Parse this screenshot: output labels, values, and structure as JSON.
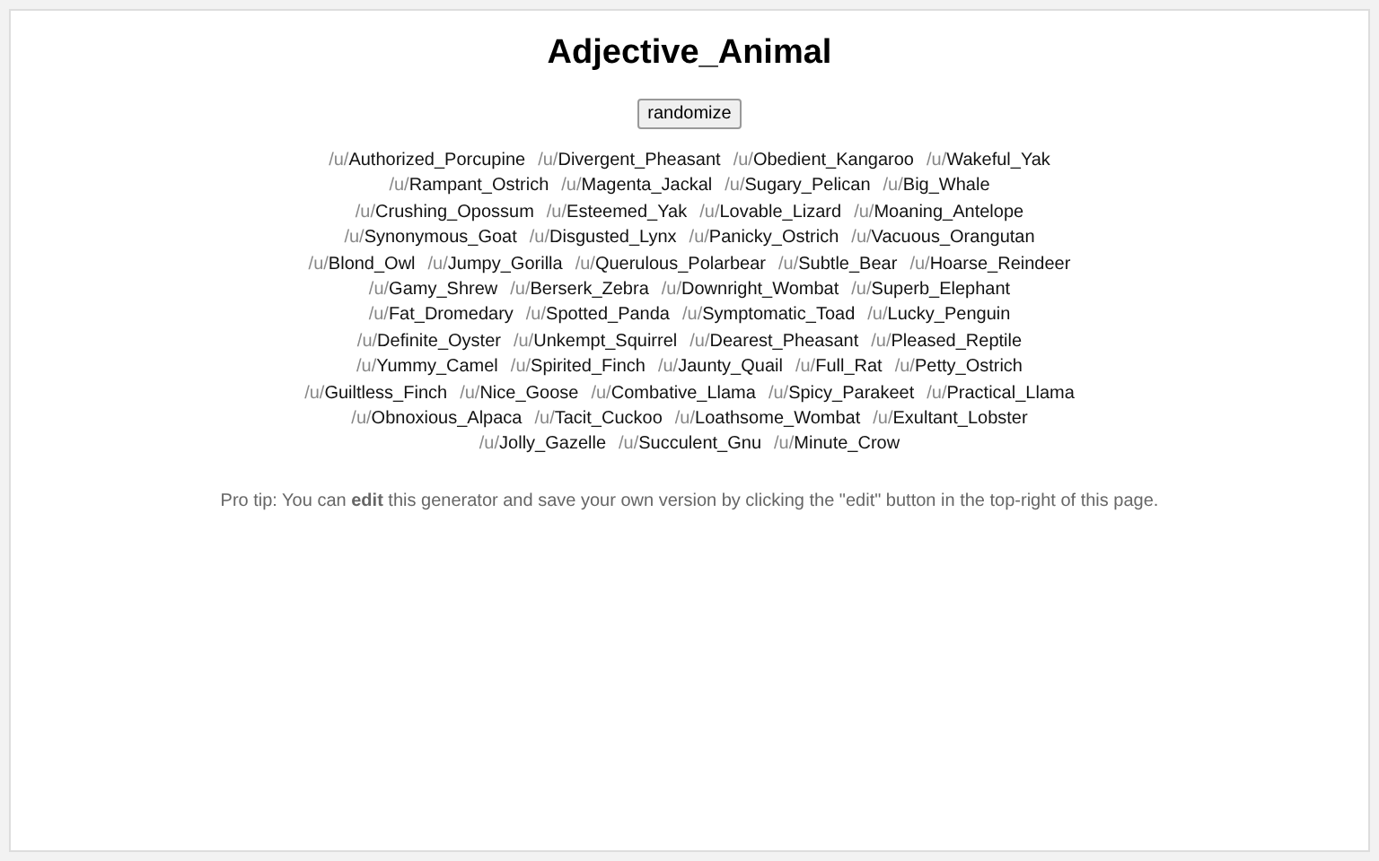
{
  "title": "Adjective_Animal",
  "button": "randomize",
  "lines": [
    [
      {
        "prefix": "/u/",
        "name": "Authorized_Porcupine"
      },
      {
        "prefix": "/u/",
        "name": "Divergent_Pheasant"
      },
      {
        "prefix": "/u/",
        "name": "Obedient_Kangaroo"
      },
      {
        "prefix": "/u/",
        "name": "Wakeful_Yak"
      }
    ],
    [
      {
        "prefix": "/u/",
        "name": "Rampant_Ostrich"
      },
      {
        "prefix": "/u/",
        "name": "Magenta_Jackal"
      },
      {
        "prefix": "/u/",
        "name": "Sugary_Pelican"
      },
      {
        "prefix": "/u/",
        "name": "Big_Whale"
      }
    ],
    [
      {
        "prefix": "/u/",
        "name": "Crushing_Opossum"
      },
      {
        "prefix": "/u/",
        "name": "Esteemed_Yak"
      },
      {
        "prefix": "/u/",
        "name": "Lovable_Lizard"
      },
      {
        "prefix": "/u/",
        "name": "Moaning_Antelope"
      }
    ],
    [
      {
        "prefix": "/u/",
        "name": "Synonymous_Goat"
      },
      {
        "prefix": "/u/",
        "name": "Disgusted_Lynx"
      },
      {
        "prefix": "/u/",
        "name": "Panicky_Ostrich"
      },
      {
        "prefix": "/u/",
        "name": "Vacuous_Orangutan"
      }
    ],
    [
      {
        "prefix": "/u/",
        "name": "Blond_Owl"
      },
      {
        "prefix": "/u/",
        "name": "Jumpy_Gorilla"
      },
      {
        "prefix": "/u/",
        "name": "Querulous_Polarbear"
      },
      {
        "prefix": "/u/",
        "name": "Subtle_Bear"
      },
      {
        "prefix": "/u/",
        "name": "Hoarse_Reindeer"
      }
    ],
    [
      {
        "prefix": "/u/",
        "name": "Gamy_Shrew"
      },
      {
        "prefix": "/u/",
        "name": "Berserk_Zebra"
      },
      {
        "prefix": "/u/",
        "name": "Downright_Wombat"
      },
      {
        "prefix": "/u/",
        "name": "Superb_Elephant"
      }
    ],
    [
      {
        "prefix": "/u/",
        "name": "Fat_Dromedary"
      },
      {
        "prefix": "/u/",
        "name": "Spotted_Panda"
      },
      {
        "prefix": "/u/",
        "name": "Symptomatic_Toad"
      },
      {
        "prefix": "/u/",
        "name": "Lucky_Penguin"
      }
    ],
    [
      {
        "prefix": "/u/",
        "name": "Definite_Oyster"
      },
      {
        "prefix": "/u/",
        "name": "Unkempt_Squirrel"
      },
      {
        "prefix": "/u/",
        "name": "Dearest_Pheasant"
      },
      {
        "prefix": "/u/",
        "name": "Pleased_Reptile"
      }
    ],
    [
      {
        "prefix": "/u/",
        "name": "Yummy_Camel"
      },
      {
        "prefix": "/u/",
        "name": "Spirited_Finch"
      },
      {
        "prefix": "/u/",
        "name": "Jaunty_Quail"
      },
      {
        "prefix": "/u/",
        "name": "Full_Rat"
      },
      {
        "prefix": "/u/",
        "name": "Petty_Ostrich"
      }
    ],
    [
      {
        "prefix": "/u/",
        "name": "Guiltless_Finch"
      },
      {
        "prefix": "/u/",
        "name": "Nice_Goose"
      },
      {
        "prefix": "/u/",
        "name": "Combative_Llama"
      },
      {
        "prefix": "/u/",
        "name": "Spicy_Parakeet"
      },
      {
        "prefix": "/u/",
        "name": "Practical_Llama"
      }
    ],
    [
      {
        "prefix": "/u/",
        "name": "Obnoxious_Alpaca"
      },
      {
        "prefix": "/u/",
        "name": "Tacit_Cuckoo"
      },
      {
        "prefix": "/u/",
        "name": "Loathsome_Wombat"
      },
      {
        "prefix": "/u/",
        "name": "Exultant_Lobster"
      }
    ],
    [
      {
        "prefix": "/u/",
        "name": "Jolly_Gazelle"
      },
      {
        "prefix": "/u/",
        "name": "Succulent_Gnu"
      },
      {
        "prefix": "/u/",
        "name": "Minute_Crow"
      }
    ]
  ],
  "tip": "Pro tip: You can **edit** this generator and save your own version by clicking the \"edit\" button in the top-right of this page."
}
